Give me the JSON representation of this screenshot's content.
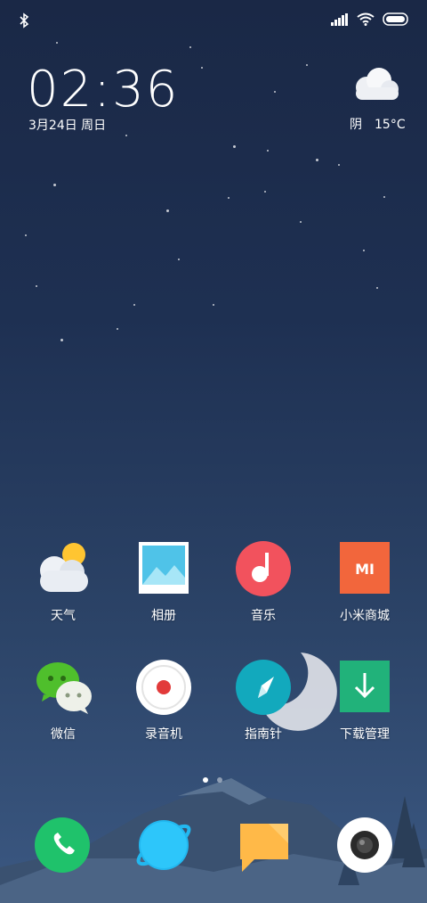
{
  "status_bar": {
    "bluetooth_icon": "bluetooth-icon",
    "signal_icon": "signal-icon",
    "wifi_icon": "wifi-icon",
    "battery_icon": "battery-icon"
  },
  "lockclock": {
    "time": "02:36",
    "date": "3月24日 周日"
  },
  "weather": {
    "icon": "cloud-icon",
    "condition": "阴",
    "temperature": "15°C"
  },
  "apps": [
    {
      "label": "天气",
      "icon": "weather-app-icon"
    },
    {
      "label": "相册",
      "icon": "gallery-app-icon"
    },
    {
      "label": "音乐",
      "icon": "music-app-icon"
    },
    {
      "label": "小米商城",
      "icon": "mi-store-app-icon",
      "icon_text": "MI"
    },
    {
      "label": "微信",
      "icon": "wechat-app-icon"
    },
    {
      "label": "录音机",
      "icon": "recorder-app-icon"
    },
    {
      "label": "指南针",
      "icon": "compass-app-icon"
    },
    {
      "label": "下载管理",
      "icon": "downloads-app-icon"
    }
  ],
  "page_indicator": {
    "pages": 2,
    "current": 1
  },
  "dock": [
    {
      "icon": "phone-app-icon",
      "color": "#1fc26b"
    },
    {
      "icon": "browser-app-icon",
      "color": "#22b8f0"
    },
    {
      "icon": "messages-app-icon",
      "color": "#ffb948"
    },
    {
      "icon": "camera-app-icon",
      "color": "#ffffff"
    }
  ]
}
